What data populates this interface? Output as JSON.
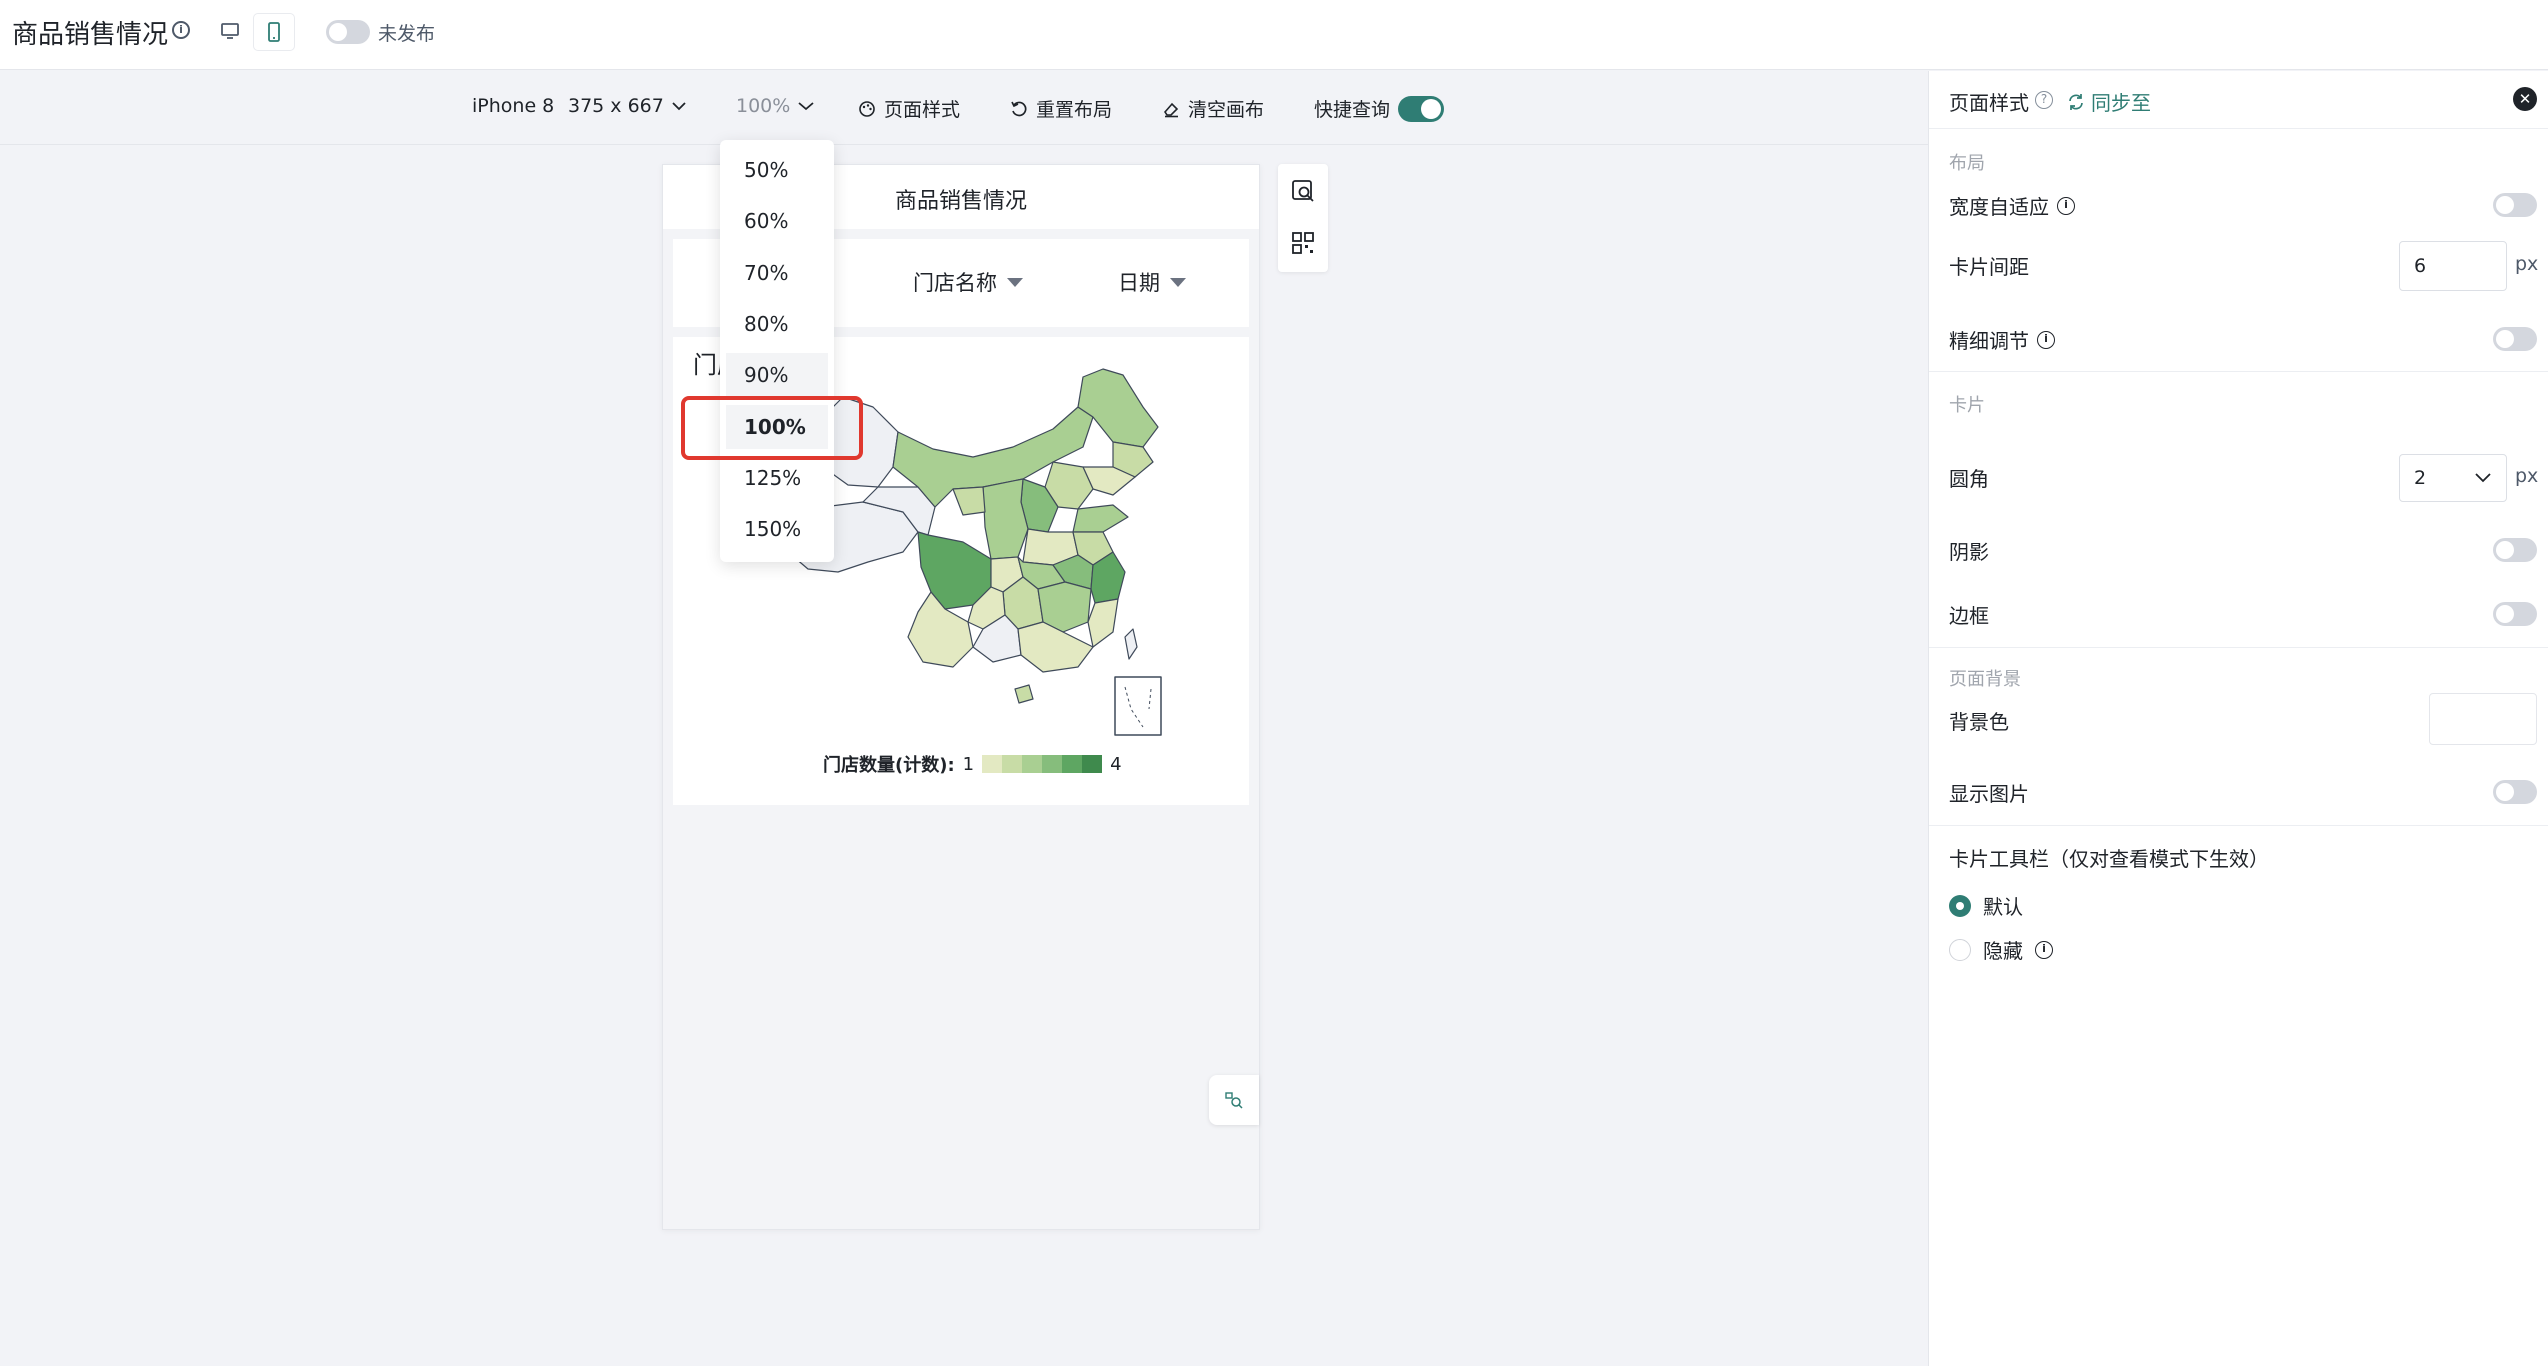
{
  "header": {
    "title": "商品销售情况",
    "publish_status": "未发布"
  },
  "toolbar": {
    "device": "iPhone 8",
    "size": "375 x 667",
    "zoom": "100%",
    "page_style": "页面样式",
    "reset_layout": "重置布局",
    "clear_canvas": "清空画布",
    "quick_query": "快捷查询"
  },
  "zoom_menu": {
    "options": [
      "50%",
      "60%",
      "70%",
      "80%",
      "90%",
      "100%",
      "125%",
      "150%"
    ],
    "selected": "100%",
    "hovered": "90%"
  },
  "phone": {
    "title": "商品销售情况",
    "filters": {
      "store": "门店名称",
      "date": "日期"
    },
    "map_card": {
      "title": "门店",
      "legend_label": "门店数量(计数):",
      "legend_min": "1",
      "legend_max": "4",
      "legend_colors": [
        "#e3e9c2",
        "#c8dca6",
        "#a9cf92",
        "#86bd7c",
        "#5ea662",
        "#3f8a4d"
      ]
    }
  },
  "right_panel": {
    "title": "页面样式",
    "sync": "同步至",
    "layout_section": "布局",
    "width_adaptive": "宽度自适应",
    "card_spacing_label": "卡片间距",
    "card_spacing_value": "6",
    "unit": "px",
    "fine_tune": "精细调节",
    "card_section": "卡片",
    "radius_label": "圆角",
    "radius_value": "2",
    "shadow": "阴影",
    "border": "边框",
    "page_bg_section": "页面背景",
    "bg_color": "背景色",
    "show_image": "显示图片",
    "toolbar_section": "卡片工具栏（仅对查看模式下生效）",
    "radio_default": "默认",
    "radio_hidden": "隐藏"
  },
  "colors": {
    "accent": "#2f7d74",
    "highlight": "#e0382e"
  }
}
